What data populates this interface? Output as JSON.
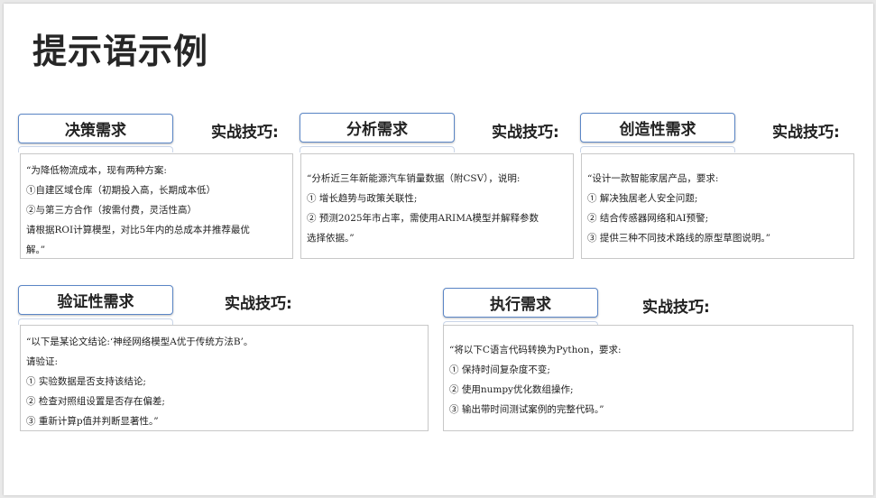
{
  "page_title": "提示语示例",
  "cards": [
    {
      "tag": "决策需求",
      "tips_label": "实战技巧:",
      "lines": [
        "“为降低物流成本，现有两种方案:",
        "①自建区域仓库（初期投入高，长期成本低）",
        "②与第三方合作（按需付费，灵活性高）",
        "请根据ROI计算模型，对比5年内的总成本并推荐最优",
        "解。”"
      ]
    },
    {
      "tag": "分析需求",
      "tips_label": "实战技巧:",
      "lines": [
        "“分析近三年新能源汽车销量数据（附CSV），说明:",
        "① 增长趋势与政策关联性;",
        "② 预测2025年市占率，需使用ARIMA模型并解释参数",
        "选择依据。”"
      ]
    },
    {
      "tag": "创造性需求",
      "tips_label": "实战技巧:",
      "lines": [
        "“设计一款智能家居产品，要求:",
        "① 解决独居老人安全问题;",
        "② 结合传感器网络和AI预警;",
        "③ 提供三种不同技术路线的原型草图说明。”"
      ]
    },
    {
      "tag": "验证性需求",
      "tips_label": "实战技巧:",
      "lines": [
        "“以下是某论文结论:‘神经网络模型A优于传统方法B’。",
        "请验证:",
        "① 实验数据是否支持该结论;",
        "② 检查对照组设置是否存在偏差;",
        "③ 重新计算p值并判断显著性。”"
      ]
    },
    {
      "tag": "执行需求",
      "tips_label": "实战技巧:",
      "lines": [
        "“将以下C语言代码转换为Python，要求:",
        "① 保持时间复杂度不变;",
        "② 使用numpy优化数组操作;",
        "③ 输出带时间测试案例的完整代码。”"
      ]
    }
  ]
}
